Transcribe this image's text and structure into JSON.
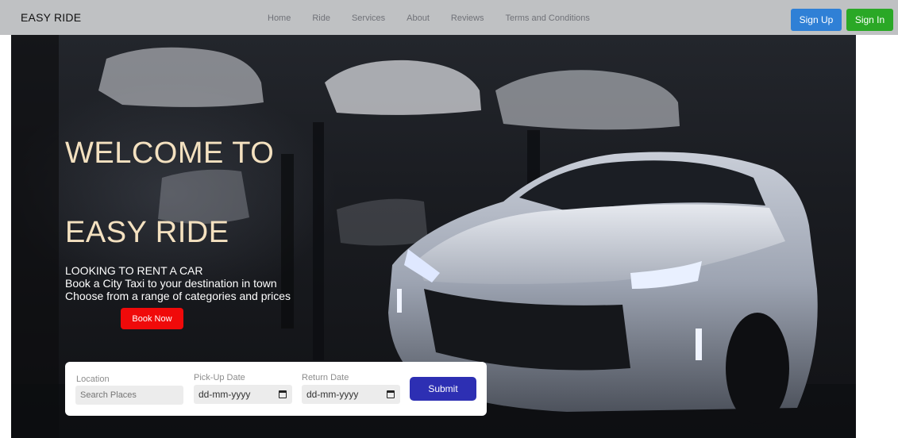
{
  "navbar": {
    "brand": "EASY RIDE",
    "links": [
      "Home",
      "Ride",
      "Services",
      "About",
      "Reviews",
      "Terms and Conditions"
    ],
    "signup_label": "Sign Up",
    "signin_label": "Sign In"
  },
  "hero": {
    "title_line1": "WELCOME TO",
    "title_line2": "EASY RIDE",
    "tagline": [
      "LOOKING TO RENT A CAR",
      "Book a City Taxi to your destination in town",
      "Choose from a range of categories and prices"
    ],
    "book_label": "Book Now"
  },
  "form": {
    "location_label": "Location",
    "location_placeholder": "Search Places",
    "pickup_label": "Pick-Up Date",
    "pickup_value": "dd-mm-yyyy",
    "return_label": "Return Date",
    "return_value": "dd-mm-yyyy",
    "submit_label": "Submit"
  },
  "colors": {
    "signup": "#2f80d6",
    "signin": "#2aa826",
    "book": "#f00a0a",
    "submit": "#2d2fb3",
    "title": "#f4e1c0"
  }
}
